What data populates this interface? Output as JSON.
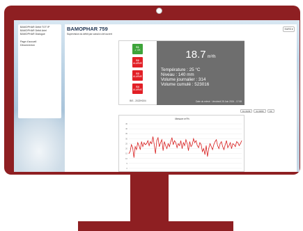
{
  "sidebar": {
    "items": [
      {
        "label": "BAMOPHAR Débit TOT IP"
      },
      {
        "label": "BAMOPHAR Débit Ariel"
      },
      {
        "label": "BAMOPHAR Dialogue"
      }
    ],
    "secondary": [
      {
        "label": "Page d'accueil"
      },
      {
        "label": "Déconnexion"
      }
    ]
  },
  "header": {
    "title": "BAMOPHAR 759",
    "subtitle": "Supervision du débit par canal à ciel ouvert",
    "language": "EURS ▾"
  },
  "status": {
    "alarms": [
      {
        "label": "S1",
        "state": "✔ OK",
        "status": "ok"
      },
      {
        "label": "S2",
        "state": "ALARME",
        "status": "alarm"
      },
      {
        "label": "S3",
        "state": "ALARME",
        "status": "alarm"
      },
      {
        "label": "S4",
        "state": "ALARME",
        "status": "alarm"
      }
    ],
    "device_id": "BIS - 2022HG04",
    "flow_value": "18.7",
    "flow_unit": "m³/h",
    "temperature": "Température : 25 °C",
    "level": "Niveau : 140 mm",
    "daily_volume": "Volume journalier : 314",
    "cumulative_volume": "Volume cumulé : 523016",
    "last_update": "Date du relevé : Vendredi 28 Juin 2024 - 17:08"
  },
  "chart_controls": {
    "from": "Du 24/06",
    "to": "Au 28/06",
    "refresh": "OK"
  },
  "colors": {
    "bezel": "#8e1f22",
    "ok": "#3ea43a",
    "alarm": "#e21f26",
    "readout_bg": "#6e6e6e",
    "series": "#d81e1e",
    "title": "#1f3553"
  },
  "chart_data": {
    "type": "line",
    "title": "Mesure m³/h",
    "xlabel": "",
    "ylabel": "",
    "ylim": [
      0,
      45
    ],
    "yticks": [
      0,
      5,
      10,
      15,
      20,
      25,
      30,
      35,
      40,
      45
    ],
    "grid": true,
    "series": [
      {
        "values": [
          15,
          17,
          24,
          21,
          11,
          22,
          19,
          26,
          23,
          19,
          27,
          22,
          26,
          24,
          25,
          28,
          23,
          27,
          25,
          32,
          24,
          15,
          28,
          31,
          22,
          26,
          29,
          18,
          27,
          23,
          20,
          25,
          22,
          27,
          31,
          24,
          28,
          26,
          21,
          25,
          23,
          28,
          20,
          26,
          23,
          29,
          25,
          18,
          27,
          22,
          24,
          30,
          26,
          28,
          23,
          21,
          26,
          24,
          17,
          20,
          14,
          23,
          12,
          20,
          25,
          22,
          19,
          24,
          27,
          29,
          23,
          20,
          25,
          27,
          22,
          19,
          24,
          28,
          21,
          23,
          26,
          20,
          25,
          24,
          22,
          27,
          26,
          23,
          25,
          28
        ]
      }
    ]
  }
}
